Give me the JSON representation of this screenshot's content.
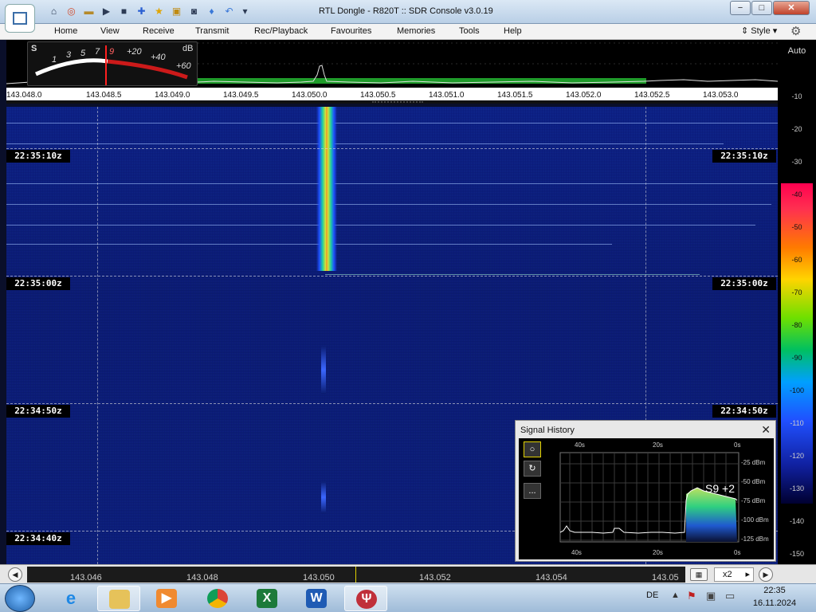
{
  "window": {
    "title": "RTL Dongle - R820T :: SDR Console v3.0.19",
    "min_label": "−",
    "max_label": "□",
    "close_label": "✕"
  },
  "menu": {
    "items": [
      "Home",
      "View",
      "Receive",
      "Transmit",
      "Rec/Playback",
      "Favourites",
      "Memories",
      "Tools",
      "Help"
    ],
    "style_label": "Style"
  },
  "smeter": {
    "s_label": "S",
    "db_label": "dB",
    "s_ticks": [
      "1",
      "3",
      "5",
      "7",
      "9"
    ],
    "db_ticks": [
      "+20",
      "+40",
      "+60"
    ]
  },
  "frequency_axis": {
    "labels": [
      "143.048.0",
      "143.048.5",
      "143.049.0",
      "143.049.5",
      "143.050.0",
      "143.050.5",
      "143.051.0",
      "143.051.5",
      "143.052.0",
      "143.052.5",
      "143.053.0"
    ]
  },
  "waterfall": {
    "time_labels": [
      "22:35:10z",
      "22:35:00z",
      "22:34:50z",
      "22:34:40z"
    ]
  },
  "right_scale": {
    "auto_label": "Auto",
    "labels": [
      "-10",
      "-20",
      "-30",
      "-40",
      "-50",
      "-60",
      "-70",
      "-80",
      "-90",
      "-100",
      "-110",
      "-120",
      "-130",
      "-140",
      "-150"
    ]
  },
  "signal_history": {
    "title": "Signal History",
    "close_label": "✕",
    "tools": [
      "○",
      "↻",
      "..."
    ],
    "top_time_labels": [
      "40s",
      "20s",
      "0s"
    ],
    "bottom_time_labels": [
      "40s",
      "20s",
      "0s"
    ],
    "dbm_labels": [
      "-25 dBm",
      "-50 dBm",
      "-75 dBm",
      "-100 dBm",
      "-125 dBm"
    ],
    "reading": "S9 +2"
  },
  "bottom_scroller": {
    "labels": [
      "143.046",
      "143.048",
      "143.050",
      "143.052",
      "143.054",
      "143.05"
    ],
    "zoom": "x2",
    "zoom_arrow": "▸"
  },
  "taskbar": {
    "apps": [
      "internet-explorer",
      "file-explorer",
      "media-player",
      "chrome",
      "excel",
      "word",
      "sdr-console"
    ],
    "excel_glyph": "X",
    "word_glyph": "W",
    "language": "DE",
    "clock_time": "22:35",
    "clock_date": "16.11.2024"
  },
  "colors": {
    "waterfall_bg": "#0b1d72",
    "signal_peak": "#e88a30",
    "history_fill": "#2fd080"
  }
}
